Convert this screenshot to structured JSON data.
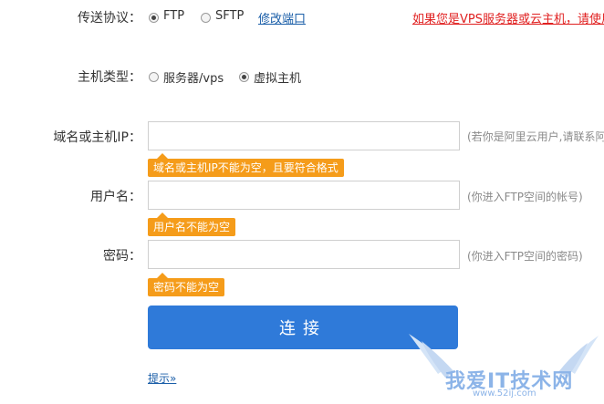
{
  "protocol": {
    "label": "传送协议：",
    "options": [
      {
        "label": "FTP",
        "checked": true
      },
      {
        "label": "SFTP",
        "checked": false
      }
    ],
    "modify_port_link": "修改端口",
    "vps_notice": "如果您是VPS服务器或云主机，请使用FTP"
  },
  "host_type": {
    "label": "主机类型：",
    "options": [
      {
        "label": "服务器/vps",
        "checked": false
      },
      {
        "label": "虚拟主机",
        "checked": true
      }
    ]
  },
  "domain": {
    "label": "域名或主机IP：",
    "value": "",
    "hint": "(若你是阿里云用户,请联系阿里",
    "error": "域名或主机IP不能为空，且要符合格式"
  },
  "username": {
    "label": "用户名：",
    "value": "",
    "hint": "(你进入FTP空间的帐号)",
    "error": "用户名不能为空"
  },
  "password": {
    "label": "密码：",
    "value": "",
    "hint": "(你进入FTP空间的密码)",
    "error": "密码不能为空"
  },
  "connect_button": "连接",
  "tips_link": "提示»",
  "watermark": {
    "text": "我爱IT技术网",
    "url": "www.52ij.com"
  },
  "colors": {
    "accent": "#2f7ad9",
    "error_tip": "#f59c1a",
    "warning_text": "#e02020",
    "link": "#1a5ea8"
  }
}
